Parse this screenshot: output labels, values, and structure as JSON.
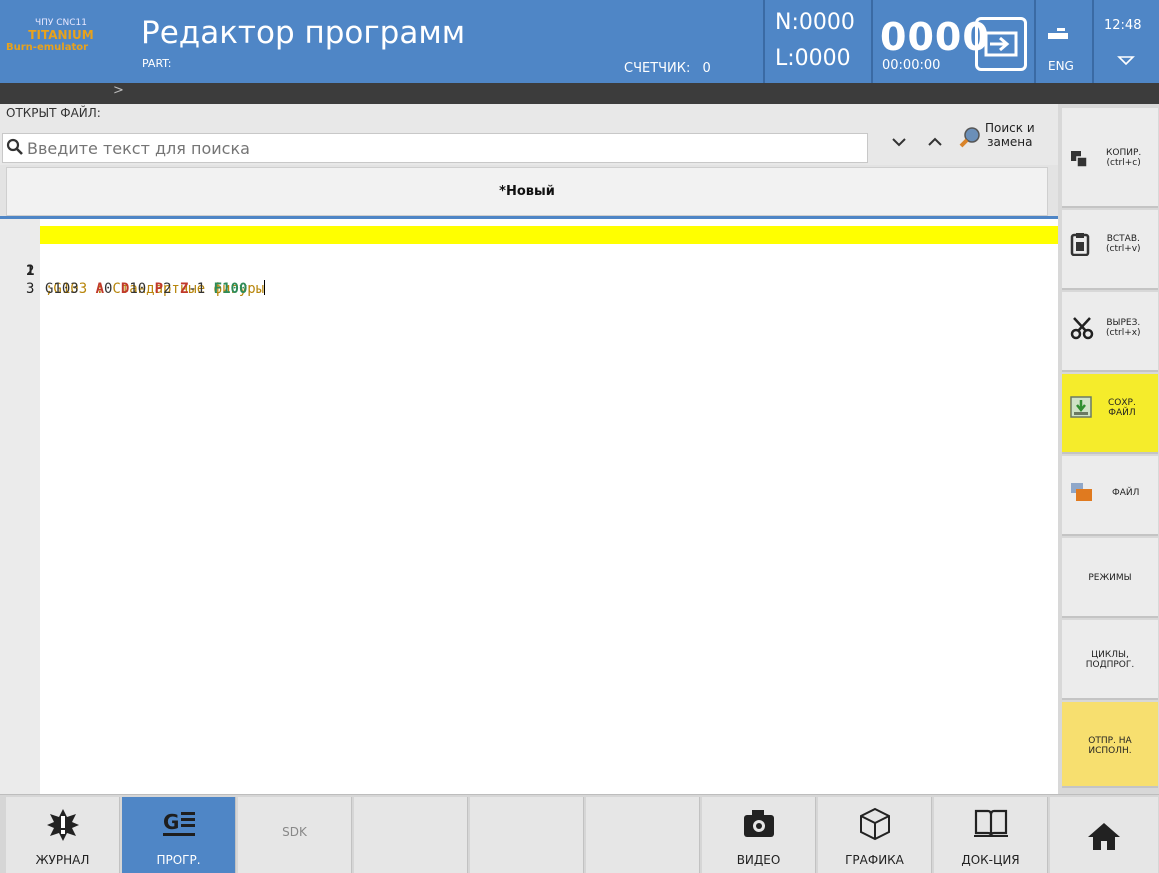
{
  "header": {
    "logo_line1": "ЧПУ CNC11",
    "logo_line2": "TITANIUM",
    "logo_line3": "Burn-emulator",
    "title": "Редактор программ",
    "part_label": "PART:",
    "counter_label": "СЧЕТЧИК:",
    "counter_value": "0",
    "n_value": "N:0000",
    "l_value": "L:0000",
    "big_counter": "0000",
    "elapsed": "00:00:00",
    "language": "ENG",
    "clock": "12:48"
  },
  "pathbar": {
    "text": ">"
  },
  "file": {
    "open_label": "ОТКРЫТ ФАЙЛ:",
    "search_placeholder": "Введите текст для поиска",
    "replace_label_1": "Поиск и",
    "replace_label_2": "замена",
    "tab_label": "*Новый"
  },
  "editor": {
    "lines": [
      {
        "num": "1",
        "text": ";G103 : Стандартные фигуры"
      },
      {
        "num": "2",
        "text": "G103  A0 D10 P2 Z-1 F100"
      },
      {
        "num": "3",
        "text": ""
      }
    ],
    "line2_tokens": {
      "g": "G103",
      "a": "A",
      "a_val": "0",
      "d": "D",
      "d_val": "10",
      "p": "P",
      "p_val": "2",
      "z": "Z",
      "z_val": "-1",
      "f": "F100"
    }
  },
  "sidebar": {
    "copy_1": "КОПИР.",
    "copy_2": "(ctrl+c)",
    "paste_1": "ВСТАВ.",
    "paste_2": "(ctrl+v)",
    "cut_1": "ВЫРЕЗ.",
    "cut_2": "(ctrl+x)",
    "save_1": "СОХР.",
    "save_2": "ФАЙЛ",
    "file": "ФАЙЛ",
    "modes": "РЕЖИМЫ",
    "cycles_1": "ЦИКЛЫ,",
    "cycles_2": "ПОДПРОГ.",
    "send_1": "ОТПР. НА",
    "send_2": "ИСПОЛН."
  },
  "bottom": {
    "journal": "ЖУРНАЛ",
    "prog": "ПРОГР.",
    "sdk": "SDK",
    "video": "ВИДЕО",
    "graphics": "ГРАФИКА",
    "docs": "ДОК-ЦИЯ"
  },
  "colors": {
    "accent": "#4f86c6",
    "highlight": "#ffff00",
    "save_bg": "#f5ec2b",
    "send_bg": "#f7df6f"
  }
}
